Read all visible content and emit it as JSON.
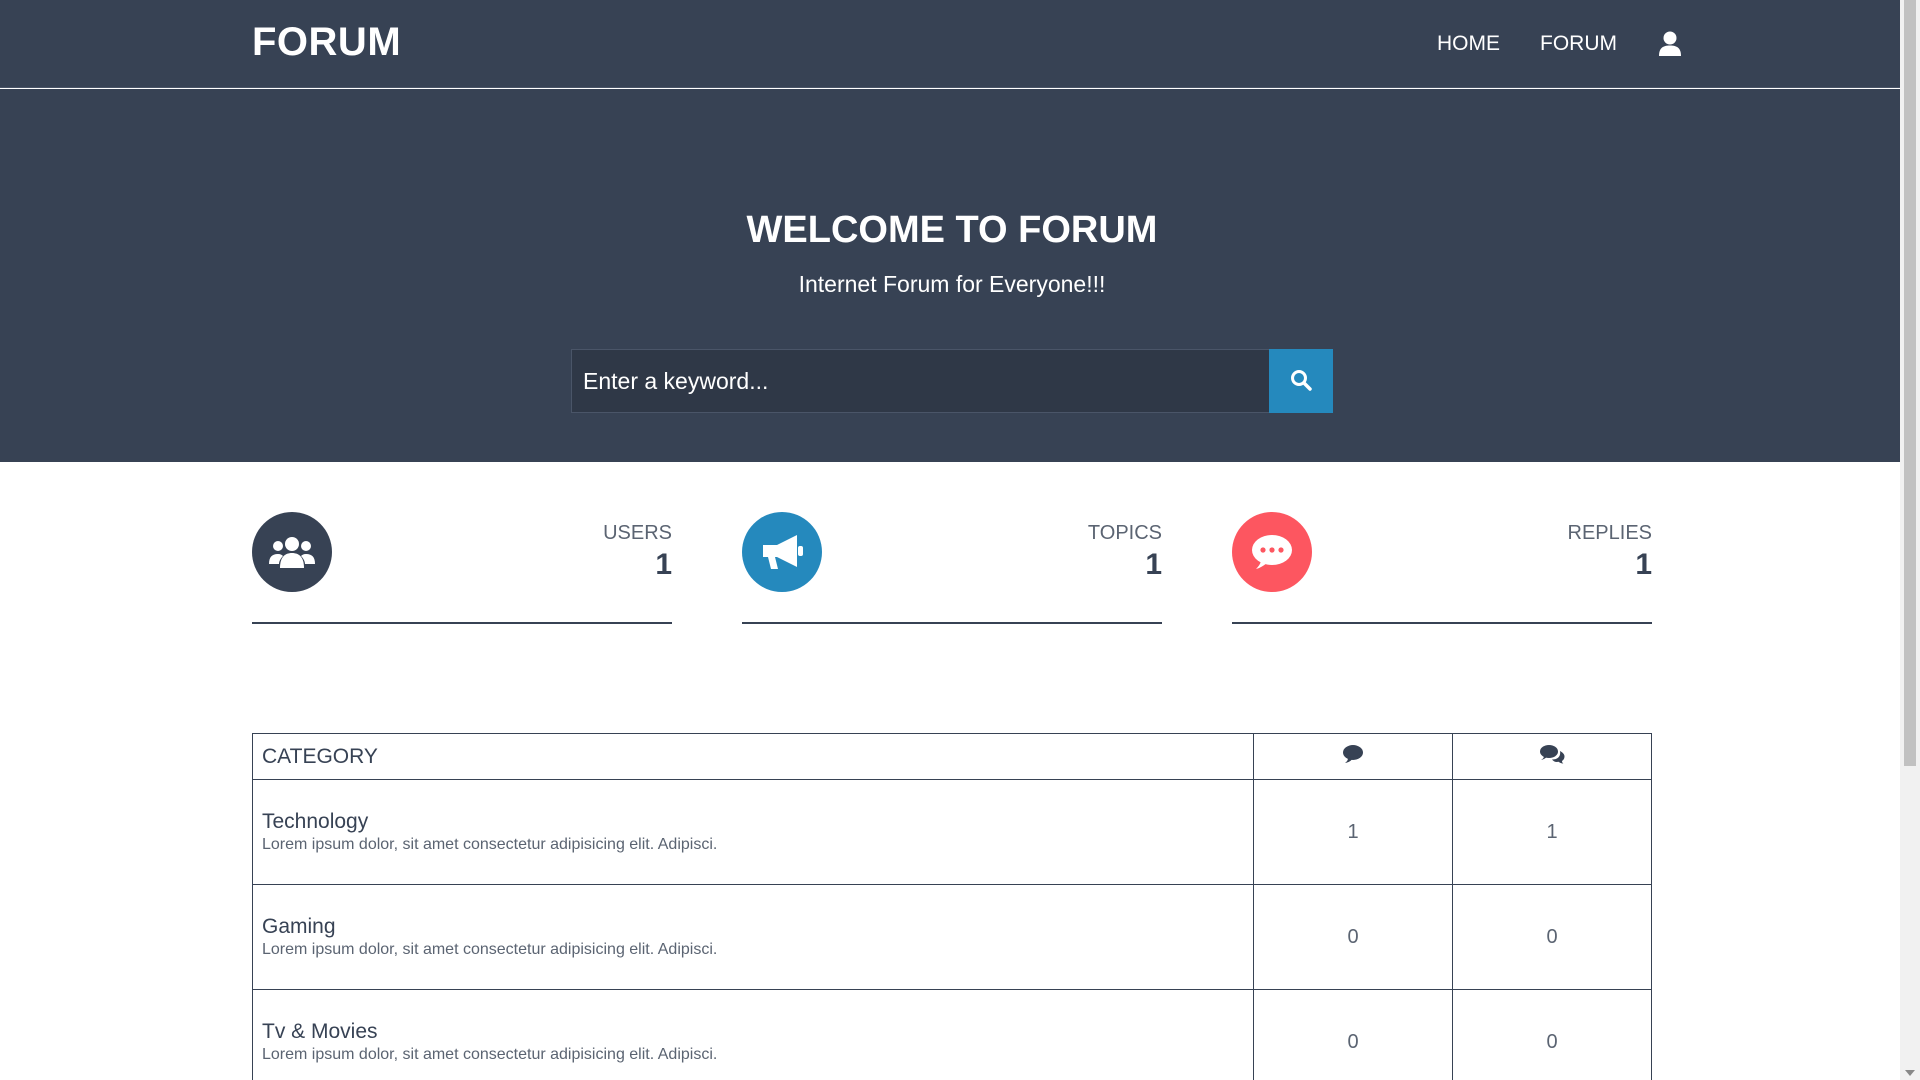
{
  "navbar": {
    "brand": "FORUM",
    "links": [
      {
        "label": "HOME"
      },
      {
        "label": "FORUM"
      }
    ],
    "user_icon": "user-icon"
  },
  "hero": {
    "title": "WELCOME TO FORUM",
    "subtitle": "Internet Forum for Everyone!!!",
    "search_placeholder": "Enter a keyword...",
    "search_icon": "search-icon"
  },
  "stats": [
    {
      "label": "USERS",
      "value": "1",
      "icon": "users-icon",
      "color": "#374254"
    },
    {
      "label": "TOPICS",
      "value": "1",
      "icon": "megaphone-icon",
      "color": "#2589bd"
    },
    {
      "label": "REPLIES",
      "value": "1",
      "icon": "comment-dots-icon",
      "color": "#fd5660"
    }
  ],
  "table": {
    "header": {
      "category": "CATEGORY",
      "topics_icon": "comment-icon",
      "replies_icon": "comments-icon"
    },
    "rows": [
      {
        "name": "Technology",
        "description": "Lorem ipsum dolor, sit amet consectetur adipisicing elit. Adipisci.",
        "topics": "1",
        "replies": "1"
      },
      {
        "name": "Gaming",
        "description": "Lorem ipsum dolor, sit amet consectetur adipisicing elit. Adipisci.",
        "topics": "0",
        "replies": "0"
      },
      {
        "name": "Tv & Movies",
        "description": "Lorem ipsum dolor, sit amet consectetur adipisicing elit. Adipisci.",
        "topics": "0",
        "replies": "0"
      }
    ]
  },
  "colors": {
    "dark": "#374254",
    "accent_blue": "#2589bd",
    "accent_red": "#fd5660"
  }
}
